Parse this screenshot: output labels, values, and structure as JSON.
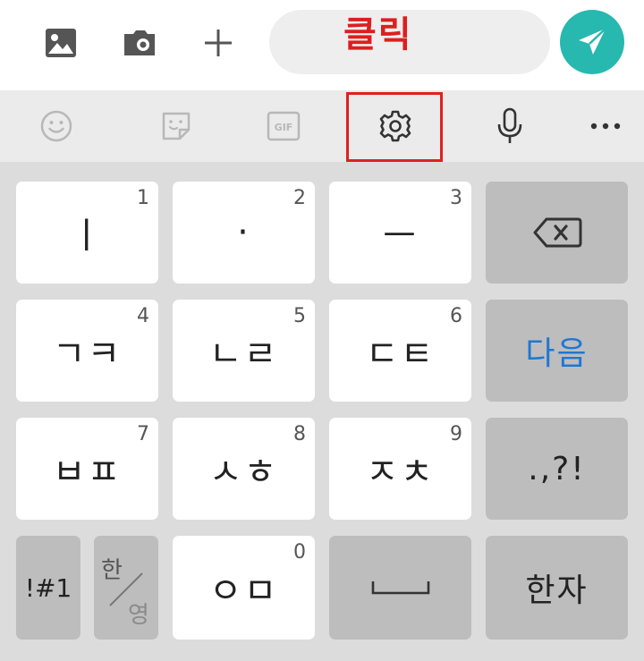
{
  "top_bar": {
    "icons": [
      "image-icon",
      "camera-icon",
      "plus-icon"
    ],
    "message_overlay": "클릭",
    "send_icon": "send-icon",
    "send_color": "#27b8b0"
  },
  "toolbar": {
    "icons": [
      "emoji-icon",
      "sticker-icon",
      "gif-icon",
      "settings-icon",
      "microphone-icon",
      "more-icon"
    ],
    "gif_label": "GIF",
    "highlight_color": "#e02020"
  },
  "keyboard": {
    "row1": [
      {
        "char": "ㅣ",
        "num": "1"
      },
      {
        "char": "·",
        "num": "2"
      },
      {
        "char": "ㅡ",
        "num": "3"
      }
    ],
    "row2": [
      {
        "char": "ㄱㅋ",
        "num": "4"
      },
      {
        "char": "ㄴㄹ",
        "num": "5"
      },
      {
        "char": "ㄷㅌ",
        "num": "6"
      }
    ],
    "row3": [
      {
        "char": "ㅂㅍ",
        "num": "7"
      },
      {
        "char": "ㅅㅎ",
        "num": "8"
      },
      {
        "char": "ㅈㅊ",
        "num": "9"
      }
    ],
    "next_label": "다음",
    "punct_label": ".,?!",
    "symbol_label": "!#1",
    "lang_top": "한",
    "lang_bottom": "영",
    "zero_key": {
      "char": "ㅇㅁ",
      "num": "0"
    },
    "hanja_label": "한자",
    "accent_blue": "#1f77d4"
  }
}
